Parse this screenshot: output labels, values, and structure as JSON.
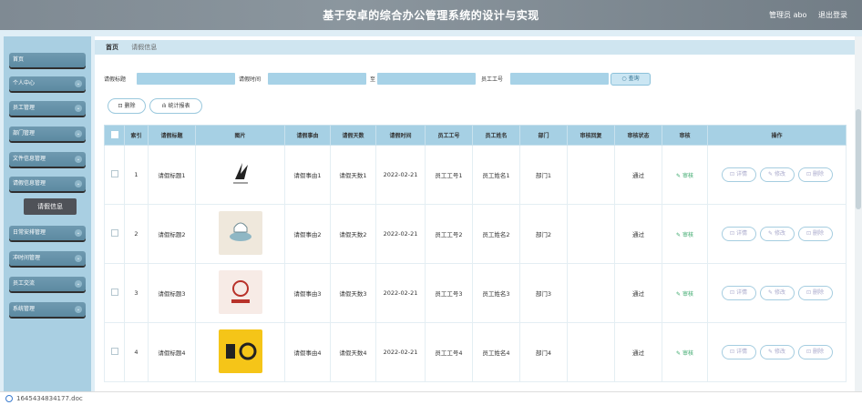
{
  "header": {
    "title": "基于安卓的综合办公管理系统的设计与实现",
    "user_label": "管理员 abo",
    "logout": "退出登录"
  },
  "sidebar": {
    "items": [
      {
        "label": "首页"
      },
      {
        "label": "个人中心"
      },
      {
        "label": "员工管理"
      },
      {
        "label": "部门管理"
      },
      {
        "label": "文件信息管理"
      },
      {
        "label": "请假信息管理"
      },
      {
        "label": "日常安排管理"
      },
      {
        "label": "冲时间管理"
      },
      {
        "label": "员工交流"
      },
      {
        "label": "系统管理"
      }
    ],
    "submenu_active": "请假信息"
  },
  "breadcrumb": {
    "home": "首页",
    "current": "请假信息"
  },
  "search": {
    "title_label": "请假标题",
    "time_label": "请假时间",
    "to_label": "至",
    "emp_label": "员工工号",
    "button": "查询"
  },
  "actions": {
    "delete": "删除",
    "stats": "统计报表"
  },
  "table": {
    "columns": [
      "索引",
      "请假标题",
      "图片",
      "请假事由",
      "请假天数",
      "请假时间",
      "员工工号",
      "员工姓名",
      "部门",
      "审核回复",
      "审核状态",
      "审核",
      "操作"
    ],
    "rows": [
      {
        "index": "1",
        "title": "请假标题1",
        "reason": "请假事由1",
        "days": "请假天数1",
        "time": "2022-02-21",
        "emp_no": "员工工号1",
        "emp_name": "员工姓名1",
        "dept": "部门1",
        "reply": "",
        "status": "通过",
        "audit": "审核"
      },
      {
        "index": "2",
        "title": "请假标题2",
        "reason": "请假事由2",
        "days": "请假天数2",
        "time": "2022-02-21",
        "emp_no": "员工工号2",
        "emp_name": "员工姓名2",
        "dept": "部门2",
        "reply": "",
        "status": "通过",
        "audit": "审核"
      },
      {
        "index": "3",
        "title": "请假标题3",
        "reason": "请假事由3",
        "days": "请假天数3",
        "time": "2022-02-21",
        "emp_no": "员工工号3",
        "emp_name": "员工姓名3",
        "dept": "部门3",
        "reply": "",
        "status": "通过",
        "audit": "审核"
      },
      {
        "index": "4",
        "title": "请假标题4",
        "reason": "请假事由4",
        "days": "请假天数4",
        "time": "2022-02-21",
        "emp_no": "员工工号4",
        "emp_name": "员工姓名4",
        "dept": "部门4",
        "reply": "",
        "status": "通过",
        "audit": "审核"
      }
    ],
    "op_detail": "详情",
    "op_edit": "修改",
    "op_delete": "删除"
  },
  "download": {
    "file": "1645434834177.doc"
  }
}
